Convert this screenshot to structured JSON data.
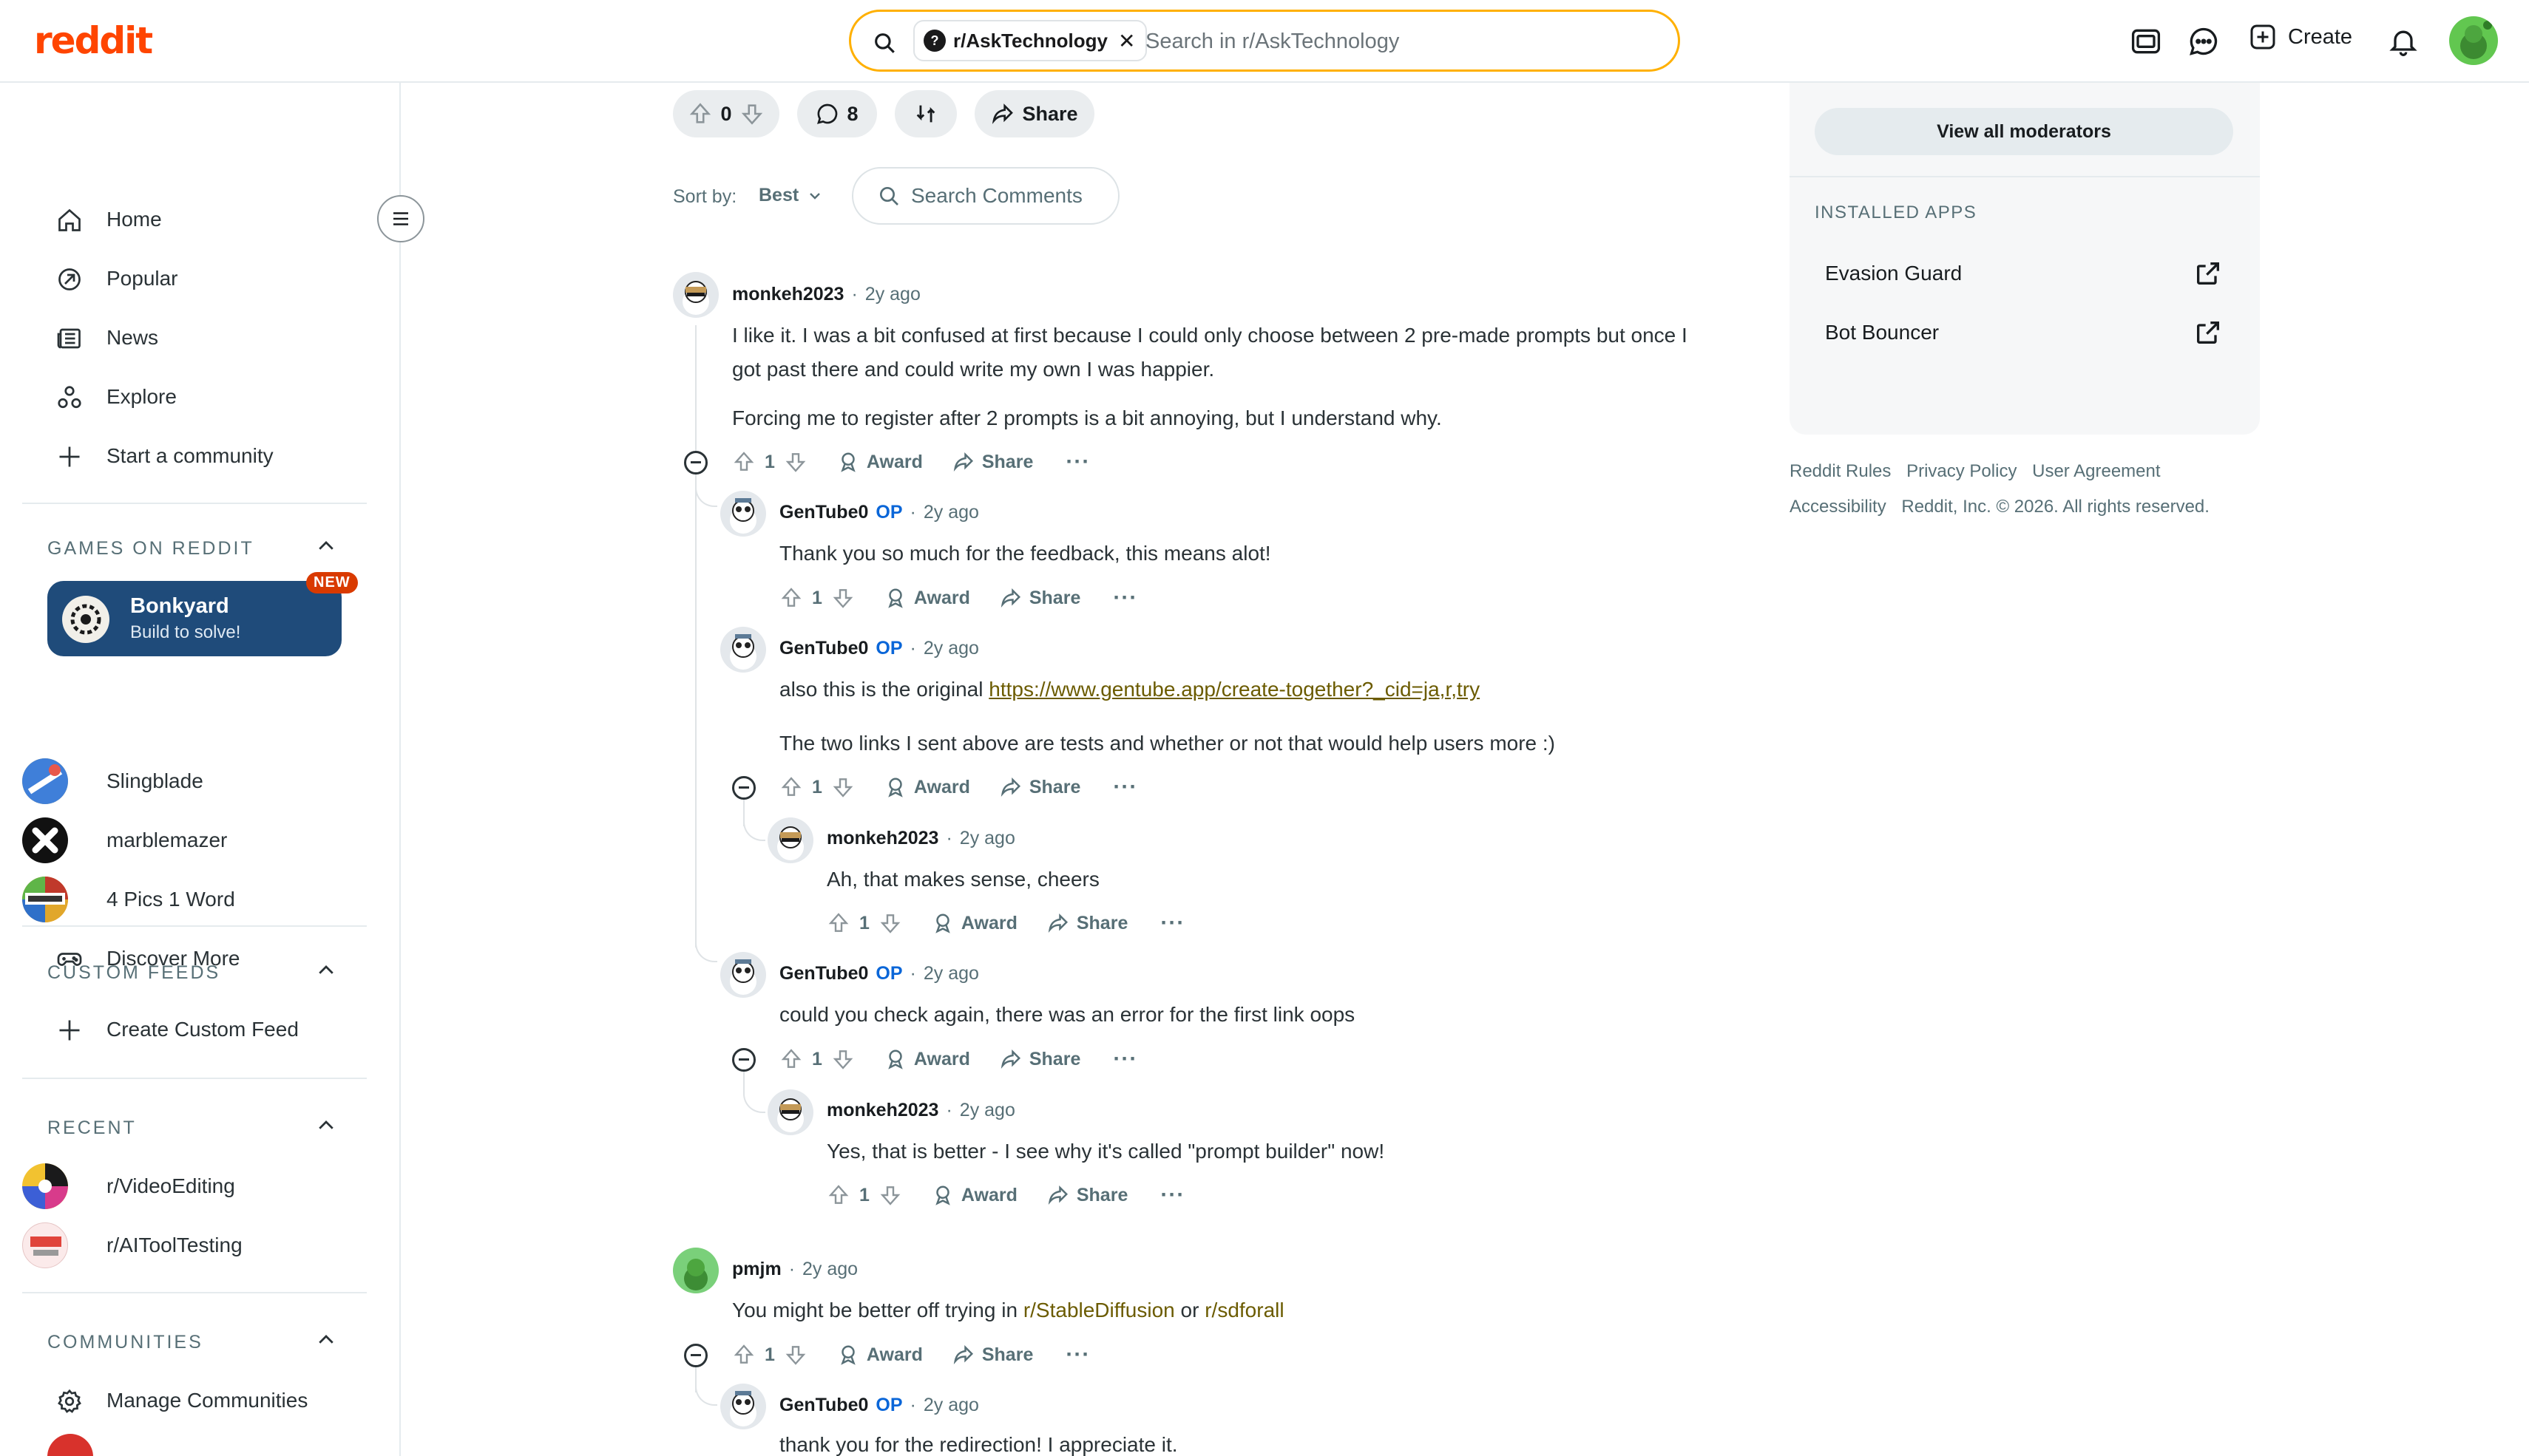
{
  "header": {
    "logo": "reddit",
    "search_chip": "r/AskTechnology",
    "search_placeholder": "Search in r/AskTechnology",
    "create_label": "Create"
  },
  "sidebar": {
    "nav": [
      "Home",
      "Popular",
      "News",
      "Explore",
      "Start a community"
    ],
    "games_title": "GAMES ON REDDIT",
    "featured_game": {
      "name": "Bonkyard",
      "subtitle": "Build to solve!",
      "badge": "NEW"
    },
    "games": [
      "Slingblade",
      "marblemazer",
      "4 Pics 1 Word",
      "Discover More"
    ],
    "custom_feeds_title": "CUSTOM FEEDS",
    "create_feed": "Create Custom Feed",
    "recent_title": "RECENT",
    "recent": [
      "r/VideoEditing",
      "r/AIToolTesting"
    ],
    "communities_title": "COMMUNITIES",
    "manage_communities": "Manage Communities"
  },
  "post_actions": {
    "score": "0",
    "comments": "8",
    "share": "Share"
  },
  "sort": {
    "label": "Sort by:",
    "value": "Best",
    "search_comments": "Search Comments"
  },
  "comments": [
    {
      "user": "monkeh2023",
      "op": "",
      "age": "2y ago",
      "lines": [
        "I like it. I was a bit confused at first because I could only choose between 2 pre-made prompts but once I",
        "got past there and could write my own I was happier."
      ],
      "para2": "Forcing me to register after 2 prompts is a bit annoying, but I understand why.",
      "votes": "1"
    },
    {
      "user": "GenTube0",
      "op": "OP",
      "age": "2y ago",
      "text": "Thank you so much for the feedback, this means alot!",
      "votes": "1"
    },
    {
      "user": "GenTube0",
      "op": "OP",
      "age": "2y ago",
      "text_prefix": "also this is the original ",
      "link": "https://www.gentube.app/create-together?_cid=ja,r,try",
      "para2": "The two links I sent above are tests and whether or not that would help users more :)",
      "votes": "1"
    },
    {
      "user": "monkeh2023",
      "op": "",
      "age": "2y ago",
      "text": "Ah, that makes sense, cheers",
      "votes": "1"
    },
    {
      "user": "GenTube0",
      "op": "OP",
      "age": "2y ago",
      "text": "could you check again, there was an error for the first link oops",
      "votes": "1"
    },
    {
      "user": "monkeh2023",
      "op": "",
      "age": "2y ago",
      "text": "Yes, that is better - I see why it's called \"prompt builder\" now!",
      "votes": "1"
    },
    {
      "user": "pmjm",
      "op": "",
      "age": "2y ago",
      "text_prefix": "You might be better off trying in ",
      "sub1": "r/StableDiffusion",
      "mid": " or ",
      "sub2": "r/sdforall",
      "votes": "1"
    },
    {
      "user": "GenTube0",
      "op": "OP",
      "age": "2y ago",
      "text": "thank you for the redirection! I appreciate it."
    }
  ],
  "action_labels": {
    "award": "Award",
    "share": "Share",
    "more": "···"
  },
  "right": {
    "view_mods": "View all moderators",
    "installed_title": "INSTALLED APPS",
    "apps": [
      "Evasion Guard",
      "Bot Bouncer"
    ],
    "footer_line1": [
      "Reddit Rules",
      "Privacy Policy",
      "User Agreement"
    ],
    "footer_line2": [
      "Accessibility",
      "Reddit, Inc. © 2026. All rights reserved."
    ]
  }
}
